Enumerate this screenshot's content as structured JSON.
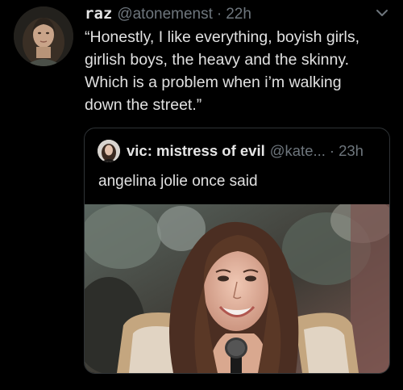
{
  "tweet": {
    "display_name": "raz",
    "handle": "@atonemenst",
    "separator": "·",
    "time": "22h",
    "text": "“Honestly, I like everything, boyish girls,\ngirlish boys, the heavy and the skinny.\nWhich is a problem when i’m walking\ndown the street.”",
    "menu_icon": "chevron-down-icon"
  },
  "quote": {
    "display_name": "vic: mistress of evil",
    "handle": "@kate...",
    "separator": "·",
    "time": "23h",
    "text": "angelina jolie once said"
  },
  "colors": {
    "background": "#000000",
    "primary_text": "#e1e1e1",
    "secondary_text": "#6e767d",
    "border": "#2f3336"
  }
}
